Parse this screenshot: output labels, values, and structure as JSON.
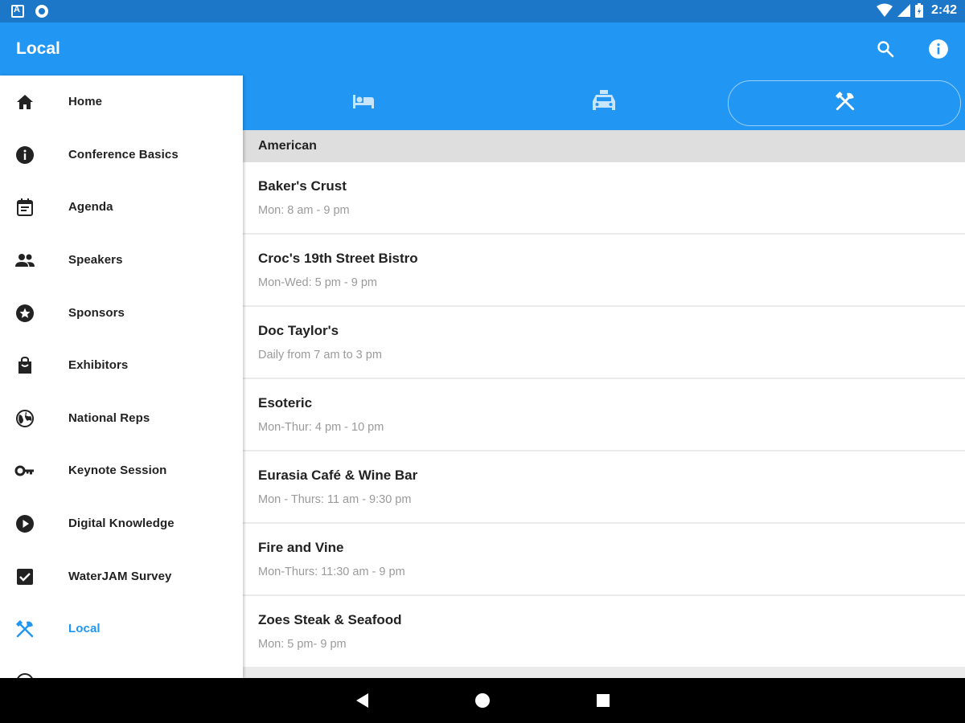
{
  "status_bar": {
    "time": "2:42"
  },
  "app_bar": {
    "title": "Local",
    "search_icon": "search-icon",
    "info_icon": "info-icon"
  },
  "drawer": {
    "items": [
      {
        "label": "Home",
        "icon": "home-icon"
      },
      {
        "label": "Conference Basics",
        "icon": "info-icon"
      },
      {
        "label": "Agenda",
        "icon": "calendar-icon"
      },
      {
        "label": "Speakers",
        "icon": "people-icon"
      },
      {
        "label": "Sponsors",
        "icon": "star-icon"
      },
      {
        "label": "Exhibitors",
        "icon": "bag-icon"
      },
      {
        "label": "National Reps",
        "icon": "globe-icon"
      },
      {
        "label": "Keynote Session",
        "icon": "key-icon"
      },
      {
        "label": "Digital Knowledge",
        "icon": "play-icon"
      },
      {
        "label": "WaterJAM Survey",
        "icon": "checkbox-icon"
      },
      {
        "label": "Local",
        "icon": "restaurant-icon",
        "active": true
      }
    ]
  },
  "tabs": [
    {
      "icon": "hotel-icon",
      "selected": false
    },
    {
      "icon": "taxi-icon",
      "selected": false
    },
    {
      "icon": "restaurant-icon",
      "selected": true
    }
  ],
  "content": {
    "section": "American",
    "restaurants": [
      {
        "name": "Baker's Crust",
        "hours": "Mon: 8 am - 9 pm"
      },
      {
        "name": "Croc's 19th Street Bistro",
        "hours": "Mon-Wed: 5 pm - 9 pm"
      },
      {
        "name": "Doc Taylor's",
        "hours": "Daily from 7 am to 3 pm"
      },
      {
        "name": "Esoteric",
        "hours": "Mon-Thur: 4 pm - 10 pm"
      },
      {
        "name": "Eurasia Café & Wine Bar",
        "hours": "Mon - Thurs: 11 am - 9:30 pm"
      },
      {
        "name": "Fire and Vine",
        "hours": "Mon-Thurs: 11:30 am - 9 pm"
      },
      {
        "name": "Zoes Steak & Seafood",
        "hours": "Mon: 5 pm- 9 pm"
      }
    ]
  },
  "colors": {
    "primary": "#2196f3",
    "status_bar": "#1c77c9",
    "section_bg": "#dedede",
    "secondary_text": "#9a9a9a"
  }
}
